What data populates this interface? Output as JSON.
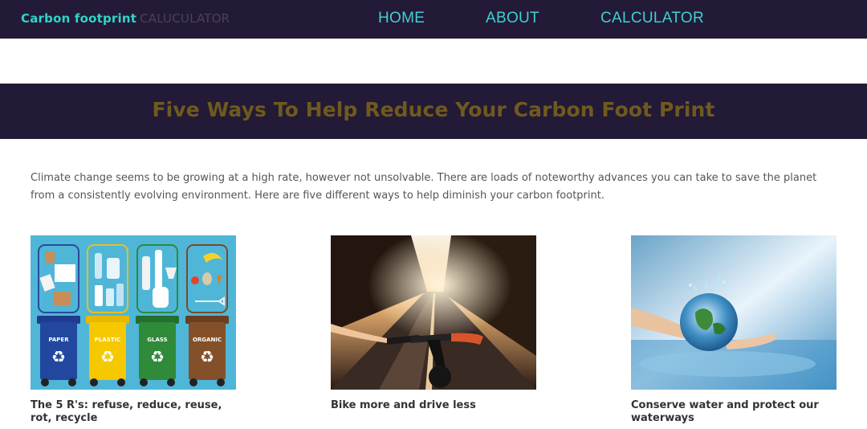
{
  "header": {
    "brand_main": "Carbon footprint",
    "brand_sub": "CALUCULATOR",
    "nav": [
      "HOME",
      "ABOUT",
      "CALCULATOR"
    ]
  },
  "banner": {
    "title": "Five Ways To Help Reduce Your Carbon Foot Print"
  },
  "intro": {
    "text": "Climate change seems to be growing at a high rate, however not unsolvable. There are loads of noteworthy advances you can take to save the planet from a consistently evolving environment. Here are five different ways to help diminish your carbon footprint."
  },
  "cards": [
    {
      "caption": "The 5 R's: refuse, reduce, reuse, rot, recycle",
      "bins": [
        "PAPER",
        "PLASTIC",
        "GLASS",
        "ORGANIC"
      ]
    },
    {
      "caption": "Bike more and drive less"
    },
    {
      "caption": "Conserve water and protect our waterways"
    }
  ],
  "colors": {
    "header_bg": "#231a37",
    "brand_accent": "#2fd4c8",
    "nav_text": "#3fd0d2",
    "banner_title": "#6f5a1e"
  }
}
